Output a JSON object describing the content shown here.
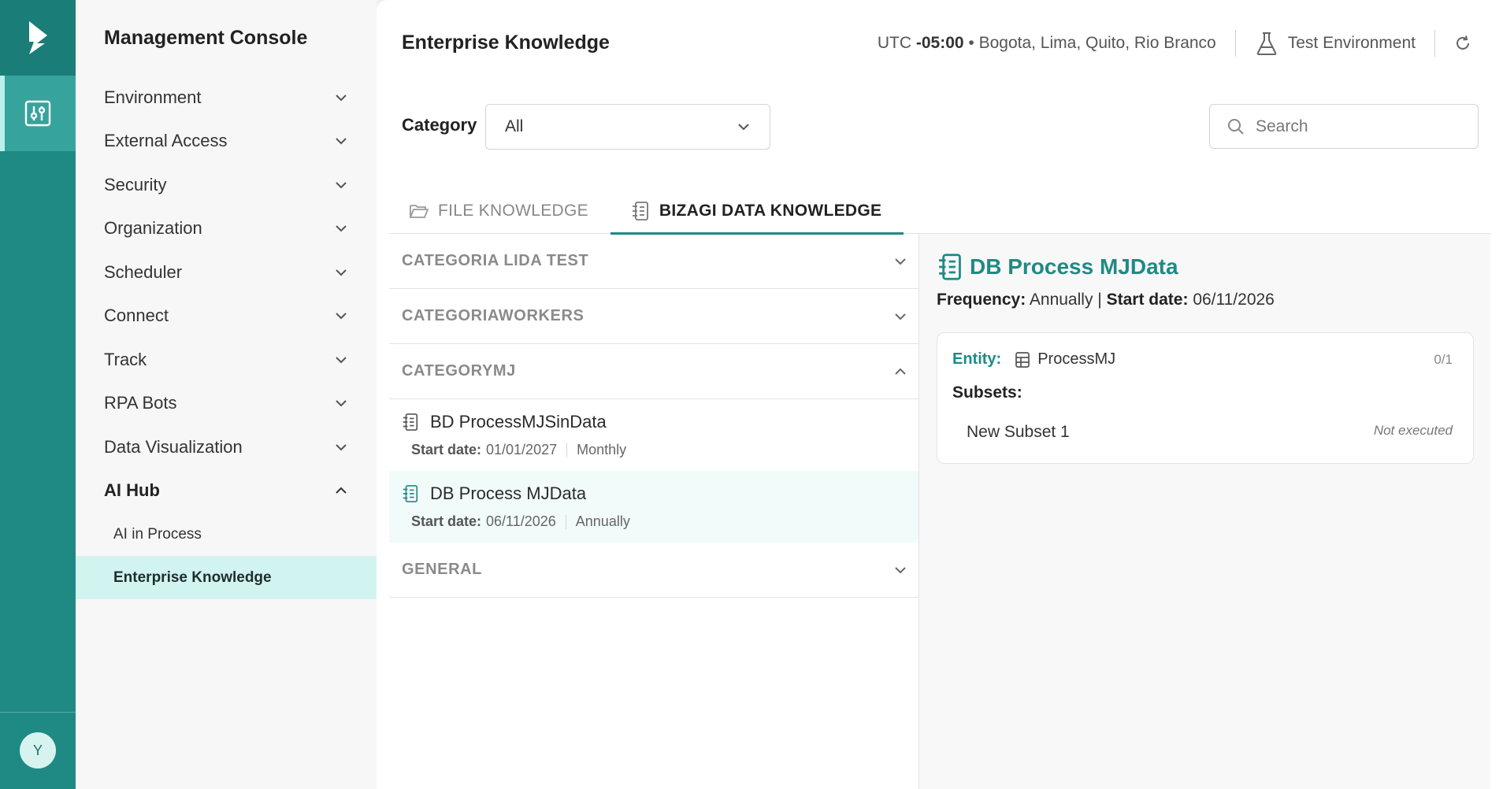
{
  "app": {
    "title": "Management Console",
    "avatar_initial": "Y"
  },
  "sidebar": {
    "items": [
      {
        "label": "Environment"
      },
      {
        "label": "External Access"
      },
      {
        "label": "Security"
      },
      {
        "label": "Organization"
      },
      {
        "label": "Scheduler"
      },
      {
        "label": "Connect"
      },
      {
        "label": "Track"
      },
      {
        "label": "RPA Bots"
      },
      {
        "label": "Data Visualization"
      },
      {
        "label": "AI Hub"
      }
    ],
    "sub_items": [
      {
        "label": "AI in Process"
      },
      {
        "label": "Enterprise Knowledge"
      }
    ]
  },
  "header": {
    "page_title": "Enterprise Knowledge",
    "tz_prefix": "UTC ",
    "tz_offset": "-05:00",
    "tz_cities": " • Bogota, Lima, Quito, Rio Branco",
    "environment": "Test Environment"
  },
  "filters": {
    "category_label": "Category",
    "category_value": "All",
    "search_placeholder": "Search"
  },
  "tabs": [
    {
      "label": "FILE KNOWLEDGE"
    },
    {
      "label": "BIZAGI DATA KNOWLEDGE"
    }
  ],
  "groups": [
    {
      "label": "CATEGORIA LIDA TEST"
    },
    {
      "label": "CATEGORIAWORKERS"
    },
    {
      "label": "CATEGORYMJ"
    },
    {
      "label": "GENERAL"
    }
  ],
  "entries": [
    {
      "title": "BD ProcessMJSinData",
      "start_label": "Start date:",
      "start_date": "01/01/2027",
      "frequency": "Monthly"
    },
    {
      "title": "DB Process MJData",
      "start_label": "Start date:",
      "start_date": "06/11/2026",
      "frequency": "Annually"
    }
  ],
  "detail": {
    "title": "DB Process MJData",
    "frequency_label": "Frequency:",
    "frequency": "Annually",
    "separator": "|",
    "start_label": "Start date:",
    "start_date": "06/11/2026",
    "entity_label": "Entity:",
    "entity_name": "ProcessMJ",
    "count": "0/1",
    "subsets_label": "Subsets:",
    "subset_name": "New Subset 1",
    "subset_status": "Not executed"
  },
  "colors": {
    "accent": "#1f8a84",
    "rail": "#1f8a84",
    "active_sub": "#d2f4f0"
  },
  "icons": {
    "logo": "bizagi-logo-icon",
    "admin": "sliders-icon",
    "environment": "flask-icon",
    "refresh": "refresh-icon",
    "search": "search-icon",
    "file_tab": "folder-icon",
    "data_tab": "data-list-icon"
  }
}
